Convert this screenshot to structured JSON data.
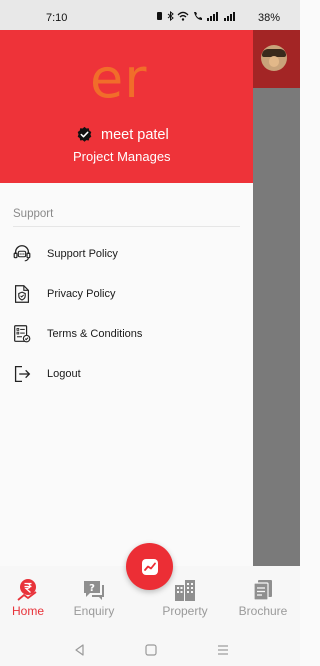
{
  "status_bar": {
    "time": "7:10",
    "battery": "38%"
  },
  "drawer": {
    "logo_text": "er",
    "user": {
      "name": "meet patel",
      "role": "Project Manages"
    },
    "section_label": "Support",
    "items": [
      {
        "label": "Support Policy",
        "icon": "headset-chat-icon"
      },
      {
        "label": "Privacy Policy",
        "icon": "shield-document-icon"
      },
      {
        "label": "Terms & Conditions",
        "icon": "checklist-document-icon"
      },
      {
        "label": "Logout",
        "icon": "logout-icon"
      }
    ]
  },
  "bottom_nav": {
    "items": [
      {
        "label": "Home",
        "icon": "rupee-home-icon",
        "active": true
      },
      {
        "label": "Enquiry",
        "icon": "chat-question-icon",
        "active": false
      },
      {
        "label": "Property",
        "icon": "buildings-icon",
        "active": false
      },
      {
        "label": "Brochure",
        "icon": "brochure-icon",
        "active": false
      }
    ]
  },
  "fab": {
    "icon": "chart-icon"
  },
  "colors": {
    "accent": "#ee3339",
    "logo": "#f16d2a",
    "inactive": "#9a9a9a"
  }
}
